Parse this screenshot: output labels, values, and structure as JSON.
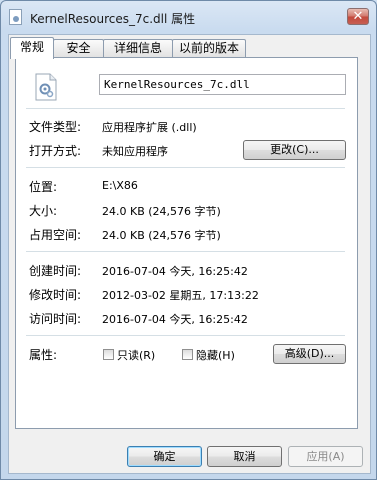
{
  "window": {
    "title": "KernelResources_7c.dll 属性",
    "close_symbol": "✕"
  },
  "tabs": [
    {
      "label": "常规",
      "active": true
    },
    {
      "label": "安全",
      "active": false
    },
    {
      "label": "详细信息",
      "active": false
    },
    {
      "label": "以前的版本",
      "active": false
    }
  ],
  "file": {
    "icon": "dll-file-icon",
    "name": "KernelResources_7c.dll"
  },
  "type_section": {
    "file_type_label": "文件类型:",
    "file_type_value": "应用程序扩展 (.dll)",
    "open_with_label": "打开方式:",
    "open_with_value": "未知应用程序",
    "change_button": "更改(C)..."
  },
  "location_section": {
    "location_label": "位置:",
    "location_value": "E:\\X86",
    "size_label": "大小:",
    "size_value": "24.0 KB (24,576 字节)",
    "size_on_disk_label": "占用空间:",
    "size_on_disk_value": "24.0 KB (24,576 字节)"
  },
  "dates_section": {
    "created_label": "创建时间:",
    "created_value": "2016-07-04 今天, 16:25:42",
    "modified_label": "修改时间:",
    "modified_value": "2012-03-02 星期五, 17:13:22",
    "accessed_label": "访问时间:",
    "accessed_value": "2016-07-04 今天, 16:25:42"
  },
  "attributes": {
    "label": "属性:",
    "readonly_label": "只读(R)",
    "readonly_checked": false,
    "hidden_label": "隐藏(H)",
    "hidden_checked": false,
    "advanced_button": "高级(D)..."
  },
  "footer": {
    "ok": "确定",
    "cancel": "取消",
    "apply": "应用(A)"
  }
}
